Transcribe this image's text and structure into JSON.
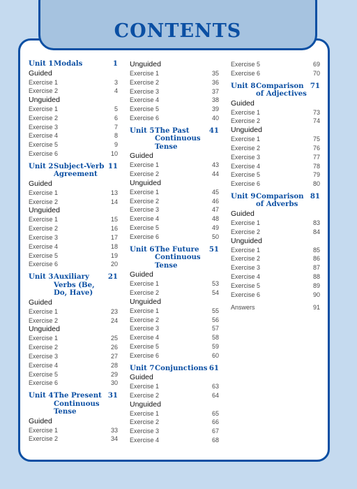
{
  "title": "CONTENTS",
  "colors": {
    "background": "#c5daef",
    "tab_fill": "#a6c3e0",
    "border": "#0b4fa3",
    "unit_heading": "#0b4fa3"
  },
  "columns": [
    [
      {
        "type": "unit",
        "num": "Unit 1",
        "name": "Modals",
        "page": "1"
      },
      {
        "type": "section",
        "label": "Guided"
      },
      {
        "type": "ex",
        "label": "Exercise 1",
        "page": "3"
      },
      {
        "type": "ex",
        "label": "Exercise 2",
        "page": "4"
      },
      {
        "type": "section",
        "label": "Unguided"
      },
      {
        "type": "ex",
        "label": "Exercise 1",
        "page": "5"
      },
      {
        "type": "ex",
        "label": "Exercise 2",
        "page": "6"
      },
      {
        "type": "ex",
        "label": "Exercise 3",
        "page": "7"
      },
      {
        "type": "ex",
        "label": "Exercise 4",
        "page": "8"
      },
      {
        "type": "ex",
        "label": "Exercise 5",
        "page": "9"
      },
      {
        "type": "ex",
        "label": "Exercise 6",
        "page": "10"
      },
      {
        "type": "unit",
        "num": "Unit 2",
        "name": "Subject-Verb Agreement",
        "page": "11"
      },
      {
        "type": "section",
        "label": "Guided"
      },
      {
        "type": "ex",
        "label": "Exercise 1",
        "page": "13"
      },
      {
        "type": "ex",
        "label": "Exercise 2",
        "page": "14"
      },
      {
        "type": "section",
        "label": "Unguided"
      },
      {
        "type": "ex",
        "label": "Exercise 1",
        "page": "15"
      },
      {
        "type": "ex",
        "label": "Exercise 2",
        "page": "16"
      },
      {
        "type": "ex",
        "label": "Exercise 3",
        "page": "17"
      },
      {
        "type": "ex",
        "label": "Exercise 4",
        "page": "18"
      },
      {
        "type": "ex",
        "label": "Exercise 5",
        "page": "19"
      },
      {
        "type": "ex",
        "label": "Exercise 6",
        "page": "20"
      },
      {
        "type": "unit",
        "num": "Unit 3",
        "name": "Auxiliary Verbs (Be, Do, Have)",
        "page": "21"
      },
      {
        "type": "section",
        "label": "Guided"
      },
      {
        "type": "ex",
        "label": "Exercise 1",
        "page": "23"
      },
      {
        "type": "ex",
        "label": "Exercise 2",
        "page": "24"
      },
      {
        "type": "section",
        "label": "Unguided"
      },
      {
        "type": "ex",
        "label": "Exercise 1",
        "page": "25"
      },
      {
        "type": "ex",
        "label": "Exercise 2",
        "page": "26"
      },
      {
        "type": "ex",
        "label": "Exercise 3",
        "page": "27"
      },
      {
        "type": "ex",
        "label": "Exercise 4",
        "page": "28"
      },
      {
        "type": "ex",
        "label": "Exercise 5",
        "page": "29"
      },
      {
        "type": "ex",
        "label": "Exercise 6",
        "page": "30"
      },
      {
        "type": "unit",
        "num": "Unit 4",
        "name": "The Present Continuous Tense",
        "page": "31"
      },
      {
        "type": "section",
        "label": "Guided"
      },
      {
        "type": "ex",
        "label": "Exercise 1",
        "page": "33"
      },
      {
        "type": "ex",
        "label": "Exercise 2",
        "page": "34"
      }
    ],
    [
      {
        "type": "section",
        "label": "Unguided"
      },
      {
        "type": "ex",
        "label": "Exercise 1",
        "page": "35"
      },
      {
        "type": "ex",
        "label": "Exercise 2",
        "page": "36"
      },
      {
        "type": "ex",
        "label": "Exercise 3",
        "page": "37"
      },
      {
        "type": "ex",
        "label": "Exercise 4",
        "page": "38"
      },
      {
        "type": "ex",
        "label": "Exercise 5",
        "page": "39"
      },
      {
        "type": "ex",
        "label": "Exercise 6",
        "page": "40"
      },
      {
        "type": "unit",
        "num": "Unit 5",
        "name": "The Past Continuous Tense",
        "page": "41"
      },
      {
        "type": "section",
        "label": "Guided"
      },
      {
        "type": "ex",
        "label": "Exercise 1",
        "page": "43"
      },
      {
        "type": "ex",
        "label": "Exercise 2",
        "page": "44"
      },
      {
        "type": "section",
        "label": "Unguided"
      },
      {
        "type": "ex",
        "label": "Exercise 1",
        "page": "45"
      },
      {
        "type": "ex",
        "label": "Exercise 2",
        "page": "46"
      },
      {
        "type": "ex",
        "label": "Exercise 3",
        "page": "47"
      },
      {
        "type": "ex",
        "label": "Exercise 4",
        "page": "48"
      },
      {
        "type": "ex",
        "label": "Exercise 5",
        "page": "49"
      },
      {
        "type": "ex",
        "label": "Exercise 6",
        "page": "50"
      },
      {
        "type": "unit",
        "num": "Unit 6",
        "name": "The Future Continuous Tense",
        "page": "51"
      },
      {
        "type": "section",
        "label": "Guided"
      },
      {
        "type": "ex",
        "label": "Exercise 1",
        "page": "53"
      },
      {
        "type": "ex",
        "label": "Exercise 2",
        "page": "54"
      },
      {
        "type": "section",
        "label": "Unguided"
      },
      {
        "type": "ex",
        "label": "Exercise 1",
        "page": "55"
      },
      {
        "type": "ex",
        "label": "Exercise 2",
        "page": "56"
      },
      {
        "type": "ex",
        "label": "Exercise 3",
        "page": "57"
      },
      {
        "type": "ex",
        "label": "Exercise 4",
        "page": "58"
      },
      {
        "type": "ex",
        "label": "Exercise 5",
        "page": "59"
      },
      {
        "type": "ex",
        "label": "Exercise 6",
        "page": "60"
      },
      {
        "type": "unit",
        "num": "Unit 7",
        "name": "Conjunctions",
        "page": "61"
      },
      {
        "type": "section",
        "label": "Guided"
      },
      {
        "type": "ex",
        "label": "Exercise 1",
        "page": "63"
      },
      {
        "type": "ex",
        "label": "Exercise 2",
        "page": "64"
      },
      {
        "type": "section",
        "label": "Unguided"
      },
      {
        "type": "ex",
        "label": "Exercise 1",
        "page": "65"
      },
      {
        "type": "ex",
        "label": "Exercise 2",
        "page": "66"
      },
      {
        "type": "ex",
        "label": "Exercise 3",
        "page": "67"
      },
      {
        "type": "ex",
        "label": "Exercise 4",
        "page": "68"
      }
    ],
    [
      {
        "type": "ex",
        "label": "Exercise 5",
        "page": "69"
      },
      {
        "type": "ex",
        "label": "Exercise 6",
        "page": "70"
      },
      {
        "type": "unit",
        "num": "Unit 8",
        "name": "Comparison of Adjectives",
        "page": "71"
      },
      {
        "type": "section",
        "label": "Guided"
      },
      {
        "type": "ex",
        "label": "Exercise 1",
        "page": "73"
      },
      {
        "type": "ex",
        "label": "Exercise 2",
        "page": "74"
      },
      {
        "type": "section",
        "label": "Unguided"
      },
      {
        "type": "ex",
        "label": "Exercise 1",
        "page": "75"
      },
      {
        "type": "ex",
        "label": "Exercise 2",
        "page": "76"
      },
      {
        "type": "ex",
        "label": "Exercise 3",
        "page": "77"
      },
      {
        "type": "ex",
        "label": "Exercise 4",
        "page": "78"
      },
      {
        "type": "ex",
        "label": "Exercise 5",
        "page": "79"
      },
      {
        "type": "ex",
        "label": "Exercise 6",
        "page": "80"
      },
      {
        "type": "unit",
        "num": "Unit 9",
        "name": "Comparison of Adverbs",
        "page": "81"
      },
      {
        "type": "section",
        "label": "Guided"
      },
      {
        "type": "ex",
        "label": "Exercise 1",
        "page": "83"
      },
      {
        "type": "ex",
        "label": "Exercise 2",
        "page": "84"
      },
      {
        "type": "section",
        "label": "Unguided"
      },
      {
        "type": "ex",
        "label": "Exercise 1",
        "page": "85"
      },
      {
        "type": "ex",
        "label": "Exercise 2",
        "page": "86"
      },
      {
        "type": "ex",
        "label": "Exercise 3",
        "page": "87"
      },
      {
        "type": "ex",
        "label": "Exercise 4",
        "page": "88"
      },
      {
        "type": "ex",
        "label": "Exercise 5",
        "page": "89"
      },
      {
        "type": "ex",
        "label": "Exercise 6",
        "page": "90"
      },
      {
        "type": "answers",
        "label": "Answers",
        "page": "91"
      }
    ]
  ]
}
